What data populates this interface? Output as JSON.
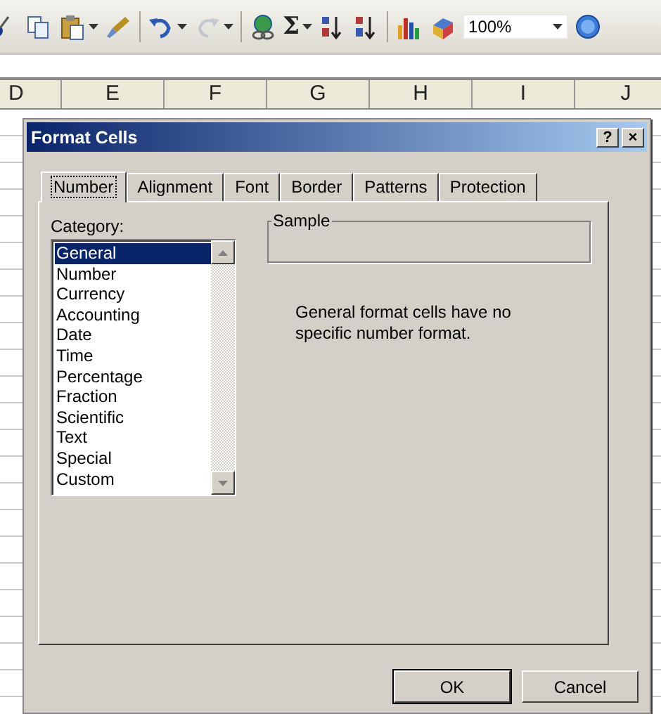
{
  "toolbar": {
    "items": [
      {
        "kind": "icon",
        "dropdown": false,
        "disabled": false
      },
      {
        "kind": "icon",
        "dropdown": false,
        "disabled": false
      },
      {
        "kind": "icon",
        "dropdown": true,
        "disabled": false
      },
      {
        "kind": "icon",
        "dropdown": false,
        "disabled": false
      },
      {
        "kind": "separator"
      },
      {
        "kind": "icon",
        "dropdown": true,
        "disabled": false
      },
      {
        "kind": "icon",
        "dropdown": true,
        "disabled": true
      },
      {
        "kind": "separator"
      },
      {
        "kind": "icon",
        "dropdown": false,
        "disabled": false
      },
      {
        "kind": "text",
        "text": "Σ",
        "dropdown": true
      },
      {
        "kind": "icon",
        "dropdown": false,
        "disabled": false
      },
      {
        "kind": "icon",
        "dropdown": false,
        "disabled": false
      },
      {
        "kind": "separator"
      },
      {
        "kind": "icon",
        "dropdown": false,
        "disabled": false
      },
      {
        "kind": "icon",
        "dropdown": false,
        "disabled": false
      },
      {
        "kind": "zoom",
        "value": "100%"
      },
      {
        "kind": "icon",
        "dropdown": false,
        "disabled": false
      }
    ]
  },
  "columns": [
    "D",
    "E",
    "F",
    "G",
    "H",
    "I",
    "J"
  ],
  "dialog": {
    "title": "Format Cells",
    "tabs": [
      {
        "label": "Number",
        "selected": true
      },
      {
        "label": "Alignment",
        "selected": false
      },
      {
        "label": "Font",
        "selected": false
      },
      {
        "label": "Border",
        "selected": false
      },
      {
        "label": "Patterns",
        "selected": false
      },
      {
        "label": "Protection",
        "selected": false
      }
    ],
    "category_label": "Category:",
    "categories": [
      {
        "label": "General",
        "selected": true
      },
      {
        "label": "Number",
        "selected": false
      },
      {
        "label": "Currency",
        "selected": false
      },
      {
        "label": "Accounting",
        "selected": false
      },
      {
        "label": "Date",
        "selected": false
      },
      {
        "label": "Time",
        "selected": false
      },
      {
        "label": "Percentage",
        "selected": false
      },
      {
        "label": "Fraction",
        "selected": false
      },
      {
        "label": "Scientific",
        "selected": false
      },
      {
        "label": "Text",
        "selected": false
      },
      {
        "label": "Special",
        "selected": false
      },
      {
        "label": "Custom",
        "selected": false
      }
    ],
    "sample_label": "Sample",
    "description": "General format cells have no specific number format.",
    "title_buttons": [
      "?",
      "×"
    ],
    "buttons": [
      {
        "label": "OK",
        "default": true
      },
      {
        "label": "Cancel",
        "default": false
      }
    ]
  }
}
